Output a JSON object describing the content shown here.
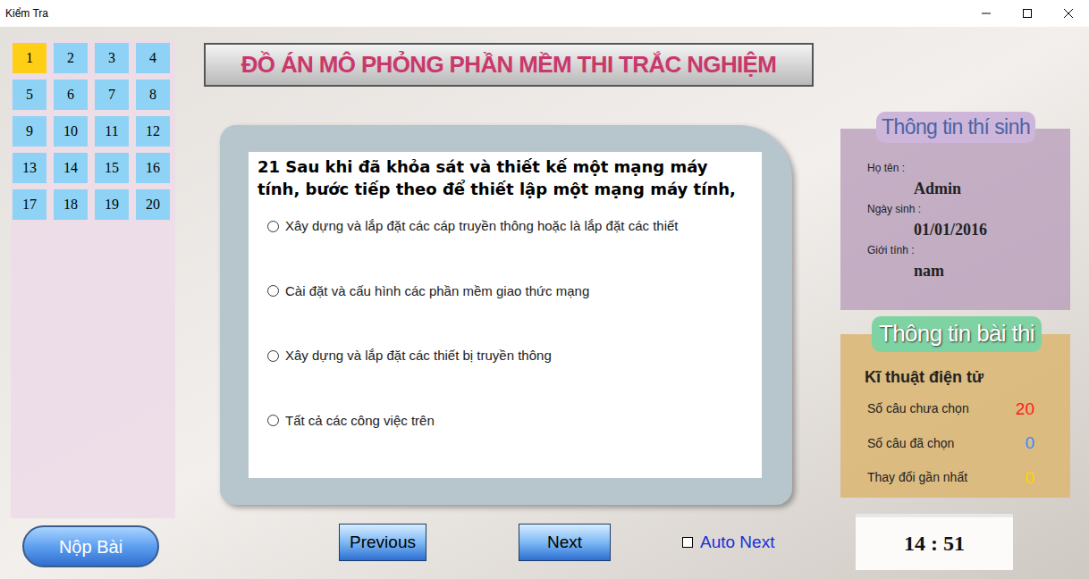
{
  "window": {
    "title": "Kiểm Tra"
  },
  "questions": [
    {
      "number": "1",
      "selected": true
    },
    {
      "number": "2",
      "selected": false
    },
    {
      "number": "3",
      "selected": false
    },
    {
      "number": "4",
      "selected": false
    },
    {
      "number": "5",
      "selected": false
    },
    {
      "number": "6",
      "selected": false
    },
    {
      "number": "7",
      "selected": false
    },
    {
      "number": "8",
      "selected": false
    },
    {
      "number": "9",
      "selected": false
    },
    {
      "number": "10",
      "selected": false
    },
    {
      "number": "11",
      "selected": false
    },
    {
      "number": "12",
      "selected": false
    },
    {
      "number": "13",
      "selected": false
    },
    {
      "number": "14",
      "selected": false
    },
    {
      "number": "15",
      "selected": false
    },
    {
      "number": "16",
      "selected": false
    },
    {
      "number": "17",
      "selected": false
    },
    {
      "number": "18",
      "selected": false
    },
    {
      "number": "19",
      "selected": false
    },
    {
      "number": "20",
      "selected": false
    }
  ],
  "banner": "ĐỒ ÁN MÔ PHỎNG PHẦN MỀM THI TRẮC NGHIỆM",
  "question": {
    "text": "21 Sau khi đã khỏa sát và thiết kế một mạng máy tính, bước tiếp theo để thiết lập một mạng máy tính,",
    "options": [
      {
        "label": "Xây dựng và lắp đặt các cáp truyền thông hoặc là lắp đặt các thiết",
        "selected": false
      },
      {
        "label": "Cài đặt và cấu hình các phần mềm giao thức  mạng",
        "selected": false
      },
      {
        "label": "Xây dựng và lắp đặt các thiết bị truyền  thông",
        "selected": false
      },
      {
        "label": "Tất cả các công việc trên",
        "selected": false
      }
    ]
  },
  "candidate": {
    "heading": "Thông tin thí sinh",
    "fields": [
      {
        "label": "Họ tên :",
        "value": "Admin"
      },
      {
        "label": "Ngày sinh :",
        "value": "01/01/2016"
      },
      {
        "label": "Giới tính :",
        "value": "nam"
      }
    ]
  },
  "exam": {
    "heading": "Thông tin bài thi",
    "subject": "Kĩ thuật điện tử",
    "stats": [
      {
        "label": "Số câu chưa chọn",
        "value": "20",
        "color": "#ff1a1a"
      },
      {
        "label": "Số câu đã chọn",
        "value": "0",
        "color": "#2f8fff"
      },
      {
        "label": "Thay đổi gần nhất",
        "value": "0",
        "color": "#ffd400"
      }
    ]
  },
  "timer": "14 : 51",
  "buttons": {
    "submit": "Nộp Bài",
    "previous": "Previous",
    "next": "Next"
  },
  "auto_next": {
    "label": "Auto Next",
    "checked": false
  }
}
